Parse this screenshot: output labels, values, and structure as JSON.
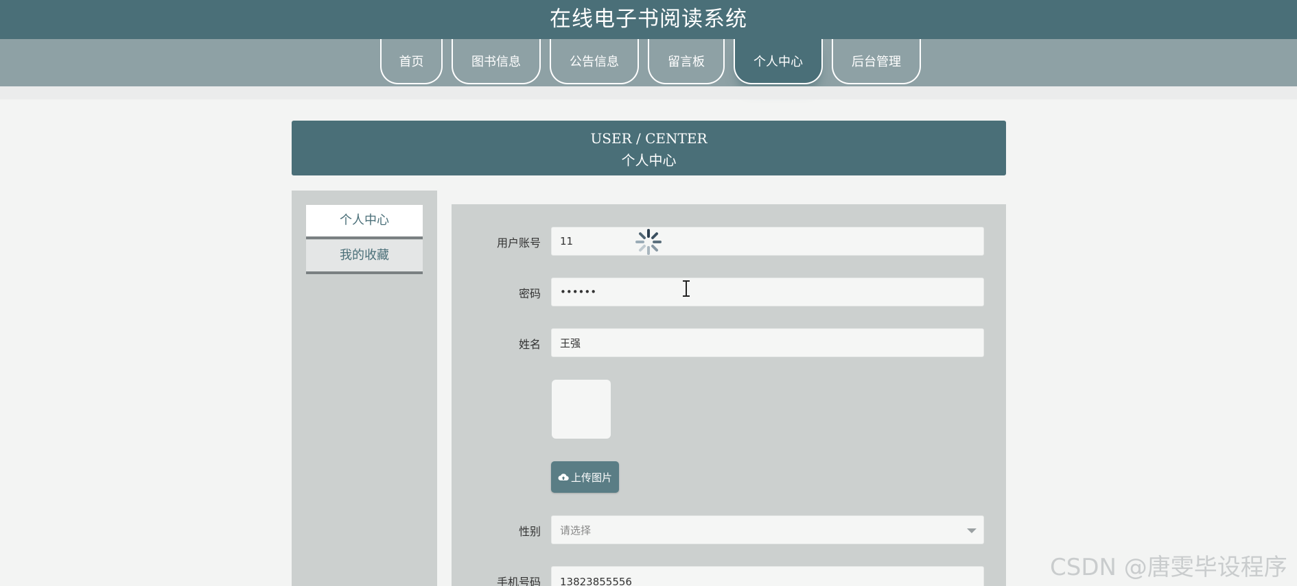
{
  "site": {
    "title": "在线电子书阅读系统"
  },
  "nav": {
    "items": [
      {
        "label": "首页"
      },
      {
        "label": "图书信息"
      },
      {
        "label": "公告信息"
      },
      {
        "label": "留言板"
      },
      {
        "label": "个人中心"
      },
      {
        "label": "后台管理"
      }
    ],
    "active": "个人中心"
  },
  "page_head": {
    "en": "USER / CENTER",
    "zh": "个人中心"
  },
  "sidebar": {
    "items": [
      {
        "label": "个人中心"
      },
      {
        "label": "我的收藏"
      }
    ]
  },
  "form": {
    "account": {
      "label": "用户账号",
      "value": "11"
    },
    "password": {
      "label": "密码",
      "value": "••••••"
    },
    "name": {
      "label": "姓名",
      "value": "王强"
    },
    "upload_label": "上传图片",
    "gender": {
      "label": "性别",
      "placeholder": "请选择"
    },
    "phone": {
      "label": "手机号码",
      "value": "13823855556"
    }
  },
  "watermark": "CSDN @唐雯毕设程序",
  "colors": {
    "primary": "#4a6f78",
    "nav_bg": "#8ea1a5",
    "panel_bg": "#ccd0cf",
    "page_bg": "#f3f4f3"
  }
}
